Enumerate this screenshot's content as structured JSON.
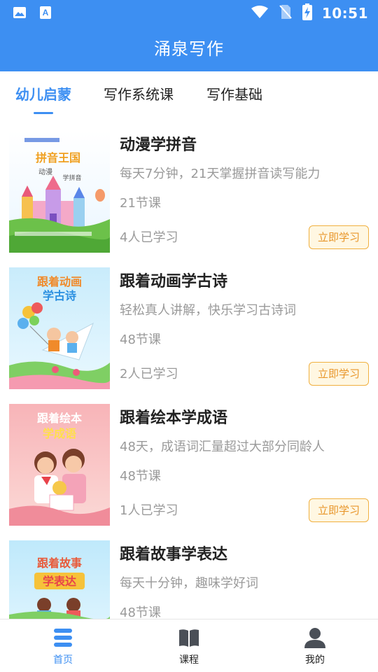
{
  "status_bar": {
    "time": "10:51"
  },
  "header": {
    "title": "涌泉写作"
  },
  "tabs": [
    {
      "label": "幼儿启蒙"
    },
    {
      "label": "写作系统课"
    },
    {
      "label": "写作基础"
    }
  ],
  "courses": [
    {
      "title": "动漫学拼音",
      "desc": "每天7分钟，21天掌握拼音读写能力",
      "lessons": "21节课",
      "learners": "4人已学习",
      "button": "立即学习",
      "thumb_lines": [
        "拼音王国",
        "动漫",
        "学拼音"
      ]
    },
    {
      "title": "跟着动画学古诗",
      "desc": "轻松真人讲解，快乐学习古诗词",
      "lessons": "48节课",
      "learners": "2人已学习",
      "button": "立即学习",
      "thumb_lines": [
        "跟着动画",
        "学古诗"
      ]
    },
    {
      "title": "跟着绘本学成语",
      "desc": "48天，成语词汇量超过大部分同龄人",
      "lessons": "48节课",
      "learners": "1人已学习",
      "button": "立即学习",
      "thumb_lines": [
        "跟着绘本",
        "学成语"
      ]
    },
    {
      "title": "跟着故事学表达",
      "desc": "每天十分钟，趣味学好词",
      "lessons": "48节课",
      "thumb_lines": [
        "跟着故事",
        "学表达"
      ]
    }
  ],
  "bottom_nav": [
    {
      "label": "首页",
      "icon": "home-list-icon"
    },
    {
      "label": "课程",
      "icon": "book-icon"
    },
    {
      "label": "我的",
      "icon": "person-icon"
    }
  ],
  "colors": {
    "primary": "#3d8ff2",
    "button_text": "#e8962a",
    "button_border": "#f0b040"
  }
}
